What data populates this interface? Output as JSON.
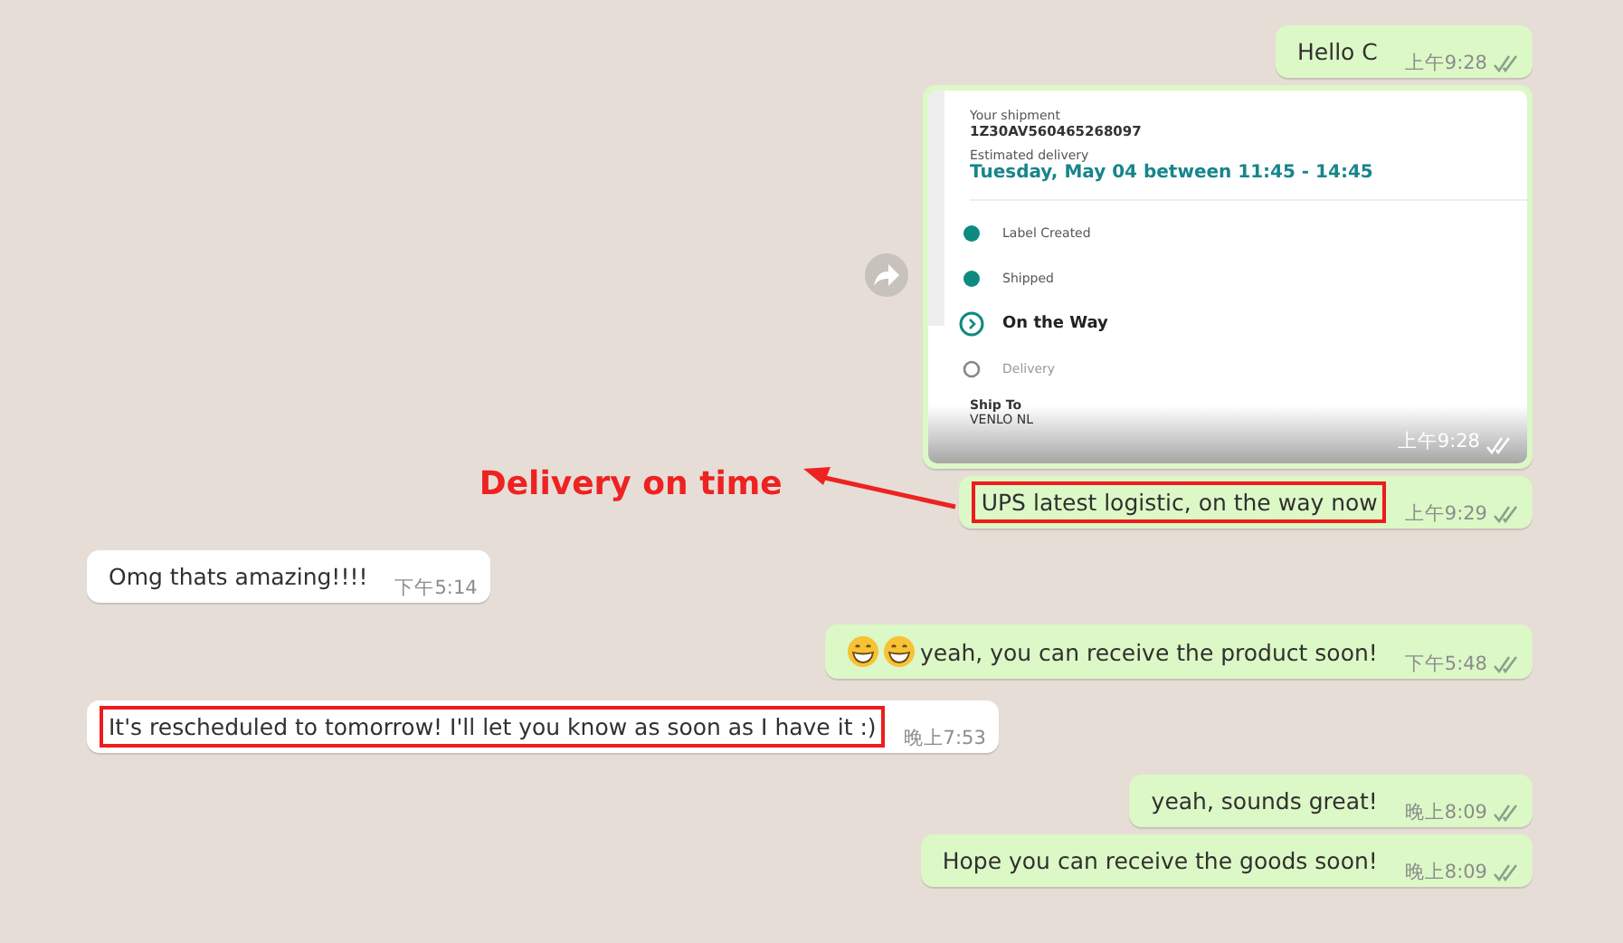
{
  "messages": [
    {
      "outgoing": true,
      "kind": "text",
      "text": "Hello C",
      "time": "上午9:28",
      "read": true,
      "highlighted": false
    },
    {
      "outgoing": true,
      "kind": "tracking",
      "time": "上午9:28",
      "read": true,
      "forward": true,
      "card": {
        "shipment_label": "Your shipment",
        "tracking_number": "1Z30AV560465268097",
        "estimate_label": "Estimated delivery",
        "estimate": "Tuesday, May 04 between 11:45 - 14:45",
        "steps": [
          {
            "label": "Label Created",
            "kind": "done"
          },
          {
            "label": "Shipped",
            "kind": "done"
          },
          {
            "label": "On the Way",
            "kind": "current"
          },
          {
            "label": "Delivery",
            "kind": "pending"
          }
        ],
        "ship_to_label": "Ship To",
        "ship_to": "VENLO NL"
      }
    },
    {
      "outgoing": true,
      "kind": "text",
      "text": "UPS latest logistic, on the way now",
      "time": "上午9:29",
      "read": true,
      "highlighted": true,
      "annotation": "Delivery on time"
    },
    {
      "outgoing": false,
      "kind": "text",
      "text": "Omg thats amazing!!!!",
      "time": "下午5:14",
      "highlighted": false
    },
    {
      "outgoing": true,
      "kind": "text",
      "icons": [
        {
          "kind": "grinning-face"
        },
        {
          "kind": "grinning-face"
        }
      ],
      "text": "yeah, you can receive the product soon!",
      "time": "下午5:48",
      "read": true,
      "highlighted": false
    },
    {
      "outgoing": false,
      "kind": "text",
      "text": "It's rescheduled to tomorrow! I'll let you know as soon as I have it :)",
      "time": "晚上7:53",
      "highlighted": true
    },
    {
      "outgoing": true,
      "kind": "text",
      "text": "yeah, sounds great!",
      "time": "晚上8:09",
      "read": true,
      "highlighted": false
    },
    {
      "outgoing": true,
      "kind": "text",
      "text": "Hope you can receive the goods soon!",
      "time": "晚上8:09",
      "read": true,
      "highlighted": false
    }
  ]
}
